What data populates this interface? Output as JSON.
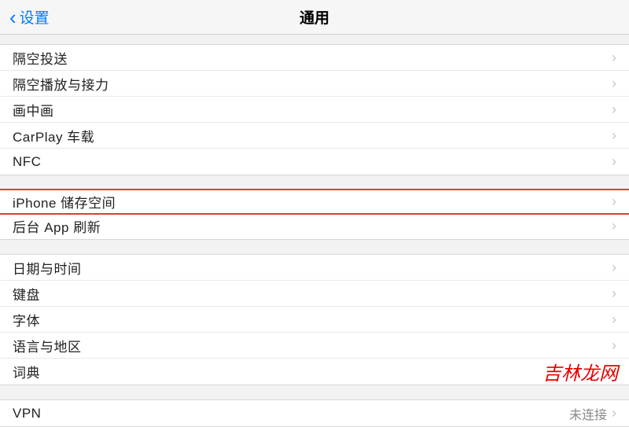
{
  "header": {
    "back_label": "设置",
    "title": "通用"
  },
  "groups": [
    {
      "items": [
        {
          "label": "隔空投送"
        },
        {
          "label": "隔空播放与接力"
        },
        {
          "label": "画中画"
        },
        {
          "label": "CarPlay 车载"
        },
        {
          "label": "NFC"
        }
      ]
    },
    {
      "items": [
        {
          "label": "iPhone 储存空间",
          "highlighted": true
        },
        {
          "label": "后台 App 刷新"
        }
      ]
    },
    {
      "items": [
        {
          "label": "日期与时间"
        },
        {
          "label": "键盘"
        },
        {
          "label": "字体"
        },
        {
          "label": "语言与地区"
        },
        {
          "label": "词典"
        }
      ]
    },
    {
      "items": [
        {
          "label": "VPN",
          "value": "未连接"
        }
      ]
    }
  ],
  "watermark": "吉林龙网"
}
